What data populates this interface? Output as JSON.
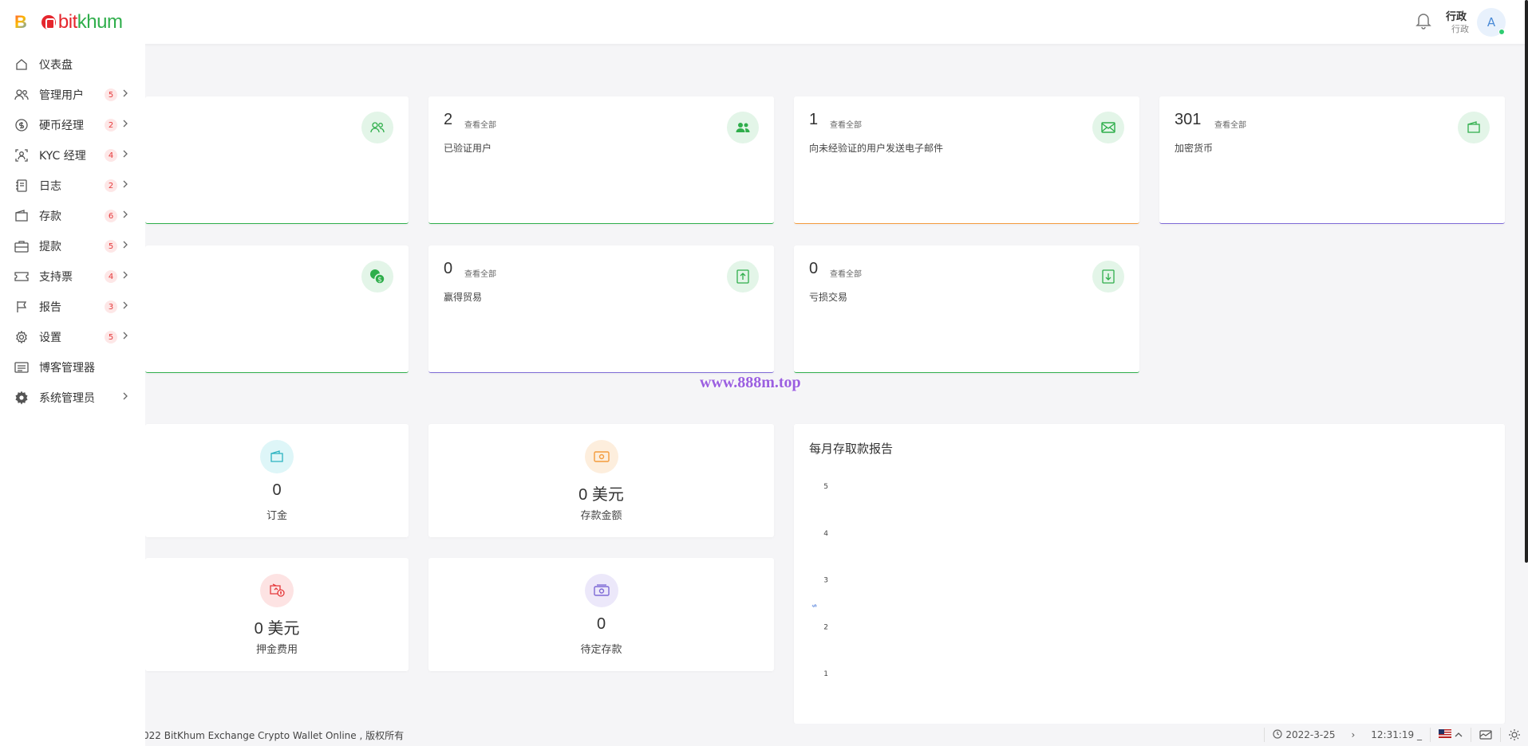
{
  "brand": {
    "logo_letter": "B",
    "name_part1": "bit",
    "name_part2": "khum"
  },
  "header": {
    "user_name": "行政",
    "user_role": "行政",
    "avatar_letter": "A"
  },
  "sidebar": {
    "items": [
      {
        "label": "仪表盘",
        "badge": "",
        "chevron": false,
        "icon": "home-icon"
      },
      {
        "label": "管理用户",
        "badge": "5",
        "chevron": true,
        "icon": "users-icon"
      },
      {
        "label": "硬币经理",
        "badge": "2",
        "chevron": true,
        "icon": "coin-icon"
      },
      {
        "label": "KYC 经理",
        "badge": "4",
        "chevron": true,
        "icon": "kyc-icon"
      },
      {
        "label": "日志",
        "badge": "2",
        "chevron": true,
        "icon": "log-icon"
      },
      {
        "label": "存款",
        "badge": "6",
        "chevron": true,
        "icon": "wallet-icon"
      },
      {
        "label": "提款",
        "badge": "5",
        "chevron": true,
        "icon": "withdraw-icon"
      },
      {
        "label": "支持票",
        "badge": "4",
        "chevron": true,
        "icon": "ticket-icon"
      },
      {
        "label": "报告",
        "badge": "3",
        "chevron": true,
        "icon": "flag-icon"
      },
      {
        "label": "设置",
        "badge": "5",
        "chevron": true,
        "icon": "gear-icon"
      },
      {
        "label": "博客管理器",
        "badge": "",
        "chevron": false,
        "icon": "blog-icon"
      },
      {
        "label": "系统管理员",
        "badge": "",
        "chevron": true,
        "icon": "cog-solid-icon"
      }
    ]
  },
  "stats": [
    {
      "value": "",
      "link": "",
      "label": "",
      "icon": "users-icon",
      "accent": "#2fae4b"
    },
    {
      "value": "2",
      "link": "查看全部",
      "label": "已验证用户",
      "icon": "verified-users-icon",
      "accent": "#2fae4b"
    },
    {
      "value": "1",
      "link": "查看全部",
      "label": "向未经验证的用户发送电子邮件",
      "icon": "mail-icon",
      "accent": "#f39b3d"
    },
    {
      "value": "301",
      "link": "查看全部",
      "label": "加密货币",
      "icon": "wallet-icon",
      "accent": "#7e6ad6"
    },
    {
      "value": "",
      "link": "",
      "label": "",
      "icon": "coins-icon",
      "accent": "#2fae4b"
    },
    {
      "value": "0",
      "link": "查看全部",
      "label": "赢得贸易",
      "icon": "trade-up-icon",
      "accent": "#7e6ad6"
    },
    {
      "value": "0",
      "link": "查看全部",
      "label": "亏损交易",
      "icon": "trade-down-icon",
      "accent": "#2fae4b"
    }
  ],
  "summary": [
    {
      "value": "0",
      "label": "订金",
      "icon": "wallet-icon",
      "color": "#2bb3c0",
      "bg": "#def6f8"
    },
    {
      "value": "0 美元",
      "label": "存款金额",
      "icon": "cash-icon",
      "color": "#f39b3d",
      "bg": "#fdeedd"
    },
    {
      "value": "0 美元",
      "label": "押金费用",
      "icon": "fee-icon",
      "color": "#e5393b",
      "bg": "#fde3e3"
    },
    {
      "value": "0",
      "label": "待定存款",
      "icon": "pending-icon",
      "color": "#7e6ad6",
      "bg": "#ece8fa"
    }
  ],
  "chart": {
    "title": "每月存取款报告",
    "chart_data": {
      "type": "bar",
      "title": "每月存取款报告",
      "ylabel": "$",
      "ylim": [
        0,
        5
      ],
      "y_ticks": [
        5,
        4,
        3,
        2,
        1
      ]
    }
  },
  "watermark": "www.888m.top",
  "footer": {
    "copyright": "022  BitKhum Exchange Crypto Wallet Online , 版权所有",
    "date": "2022-3-25",
    "time": "12:31:19 _"
  }
}
